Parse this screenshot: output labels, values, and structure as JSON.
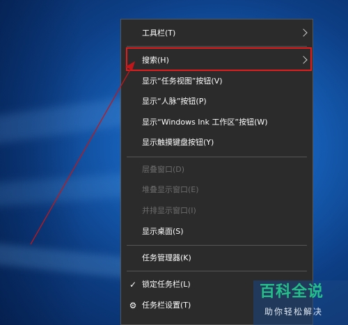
{
  "context_menu": {
    "items": [
      {
        "label": "工具栏(T)",
        "submenu": true,
        "enabled": true
      },
      {
        "label": "搜索(H)",
        "submenu": true,
        "enabled": true,
        "highlighted": true
      },
      {
        "label": "显示“任务视图”按钮(V)",
        "enabled": true
      },
      {
        "label": "显示“人脉”按钮(P)",
        "enabled": true
      },
      {
        "label": "显示“Windows Ink 工作区”按钮(W)",
        "enabled": true
      },
      {
        "label": "显示触摸键盘按钮(Y)",
        "enabled": true
      },
      {
        "label": "层叠窗口(D)",
        "enabled": false
      },
      {
        "label": "堆叠显示窗口(E)",
        "enabled": false
      },
      {
        "label": "并排显示窗口(I)",
        "enabled": false
      },
      {
        "label": "显示桌面(S)",
        "enabled": true
      },
      {
        "label": "任务管理器(K)",
        "enabled": true
      },
      {
        "label": "锁定任务栏(L)",
        "enabled": true,
        "icon": "checkmark-icon"
      },
      {
        "label": "任务栏设置(T)",
        "enabled": true,
        "icon": "gear-icon"
      }
    ]
  },
  "annotation": {
    "highlight_color": "#e11d1d",
    "arrow_color": "#c0171a"
  },
  "watermark": {
    "title": "百科全说",
    "subtitle": "助你轻松解决"
  }
}
